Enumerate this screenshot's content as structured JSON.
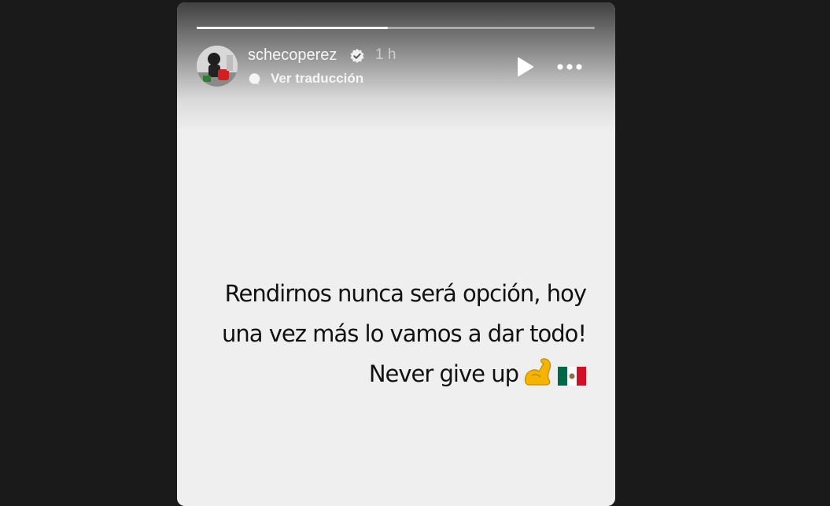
{
  "story": {
    "username": "schecoperez",
    "timestamp": "1 h",
    "translate_label": "Ver traducción",
    "progress": 0.48,
    "caption_lines": [
      "Rendirnos nunca será opción, hoy",
      "una vez más lo vamos a dar todo!",
      "Never give up"
    ],
    "caption_icons": [
      "flexed-biceps-icon",
      "mexico-flag-icon"
    ]
  },
  "icons": {
    "verified": "verified-badge-icon",
    "play": "play-icon",
    "more": "more-options-icon",
    "translate": "translate-icon"
  },
  "colors": {
    "page_background": "#1a1a1a",
    "story_background": "#efefef",
    "text_light": "#f5f5f5",
    "caption_text": "#111111",
    "flag_green": "#006847",
    "flag_red": "#ce1126"
  }
}
